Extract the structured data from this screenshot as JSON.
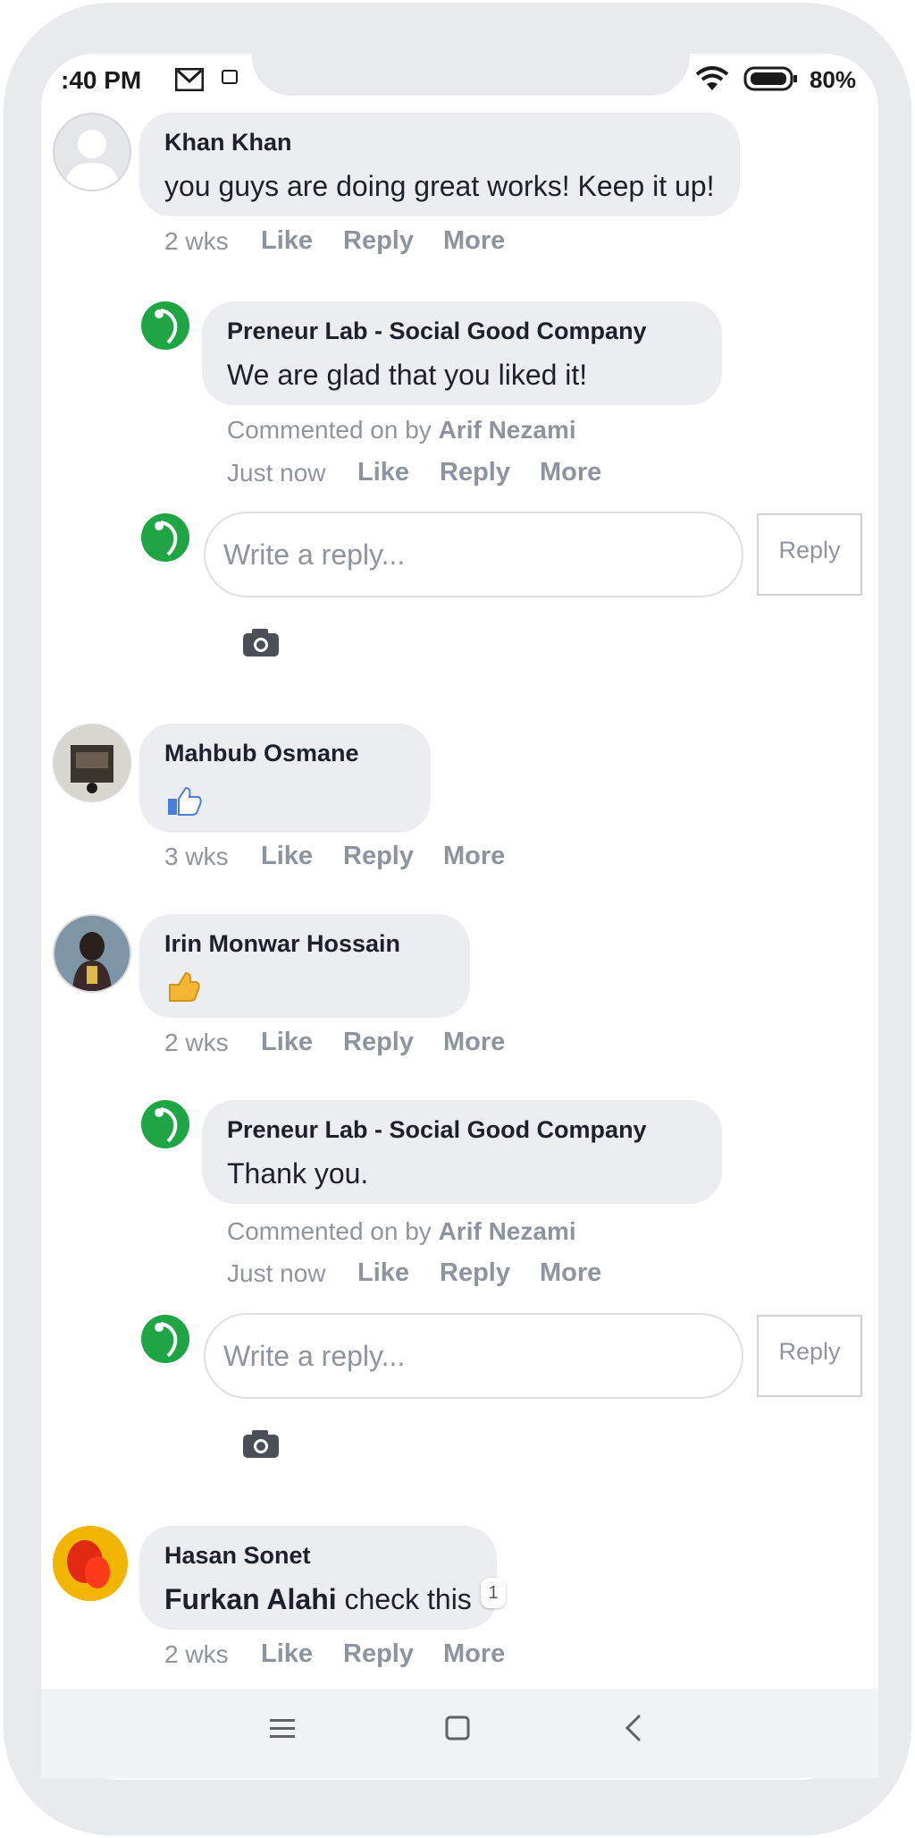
{
  "status": {
    "time": ":40 PM",
    "battery": "80%"
  },
  "comments": [
    {
      "author": "Khan Khan",
      "text": "you guys are doing great works! Keep it up!",
      "age": "2 wks",
      "reply": {
        "author": "Preneur Lab - Social Good Company",
        "text": "We are glad that you liked it!",
        "by_prefix": "Commented on by",
        "by_name": "Arif Nezami",
        "age": "Just now"
      }
    },
    {
      "author": "Mahbub Osmane",
      "age": "3 wks"
    },
    {
      "author": "Irin Monwar Hossain",
      "age": "2 wks",
      "reply": {
        "author": "Preneur Lab - Social Good Company",
        "text": "Thank you.",
        "by_prefix": "Commented on by",
        "by_name": "Arif Nezami",
        "age": "Just now"
      }
    },
    {
      "author": "Hasan Sonet",
      "mention": "Furkan Alahi",
      "text": " check this",
      "badge": "1",
      "age": "2 wks"
    }
  ],
  "actions": {
    "like": "Like",
    "reply": "Reply",
    "more": "More"
  },
  "reply_box": {
    "placeholder": "Write a reply...",
    "button": "Reply"
  },
  "icons": {
    "camera": "camera-icon",
    "thumbs_up": "thumbs-up-icon",
    "nav_menu": "menu-icon",
    "nav_home": "home-icon",
    "nav_back": "back-icon"
  },
  "colors": {
    "bubble": "#ebedf0",
    "brand_green": "#1fa544",
    "action_grey": "#8d949e"
  }
}
